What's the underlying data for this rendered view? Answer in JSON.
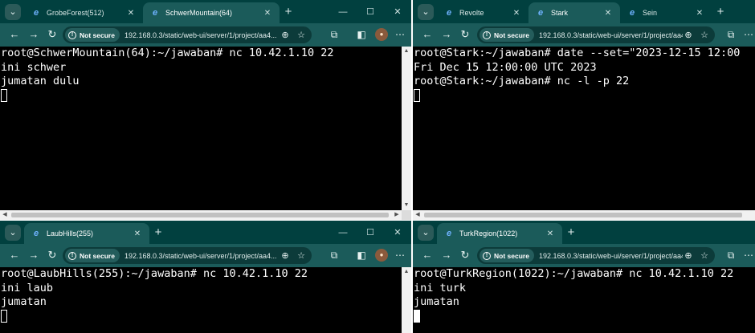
{
  "colors": {
    "tabbar": "#01403f",
    "toolbar": "#1b5b5a",
    "terminal_bg": "#000000",
    "terminal_fg": "#ffffff"
  },
  "icons": {
    "favicon": "edge-favicon",
    "security": "warning-icon"
  },
  "windows": [
    {
      "id": "tl",
      "tabs": [
        {
          "label": "GrobeForest(512)",
          "active": false
        },
        {
          "label": "SchwerMountain(64)",
          "active": true
        }
      ],
      "security_label": "Not secure",
      "url": "192.168.0.3/static/web-ui/server/1/project/aa4...",
      "terminal_lines": [
        "root@SchwerMountain(64):~/jawaban# nc 10.42.1.10 22",
        "ini schwer",
        "jumatan dulu"
      ]
    },
    {
      "id": "tr",
      "tabs": [
        {
          "label": "Revolte",
          "active": false
        },
        {
          "label": "Stark",
          "active": true
        },
        {
          "label": "Sein",
          "active": false
        }
      ],
      "security_label": "Not secure",
      "url": "192.168.0.3/static/web-ui/server/1/project/aa4...",
      "terminal_lines": [
        "root@Stark:~/jawaban# date --set=\"2023-12-15 12:00",
        "Fri Dec 15 12:00:00 UTC 2023",
        "root@Stark:~/jawaban# nc -l -p 22"
      ]
    },
    {
      "id": "bl",
      "tabs": [
        {
          "label": "LaubHills(255)",
          "active": true
        }
      ],
      "security_label": "Not secure",
      "url": "192.168.0.3/static/web-ui/server/1/project/aa4...",
      "terminal_lines": [
        "root@LaubHills(255):~/jawaban# nc 10.42.1.10 22",
        "ini laub",
        "jumatan"
      ]
    },
    {
      "id": "br",
      "tabs": [
        {
          "label": "TurkRegion(1022)",
          "active": true
        }
      ],
      "security_label": "Not secure",
      "url": "192.168.0.3/static/web-ui/server/1/project/aa4...",
      "terminal_lines": [
        "root@TurkRegion(1022):~/jawaban# nc 10.42.1.10 22",
        "ini turk",
        "jumatan"
      ]
    }
  ]
}
